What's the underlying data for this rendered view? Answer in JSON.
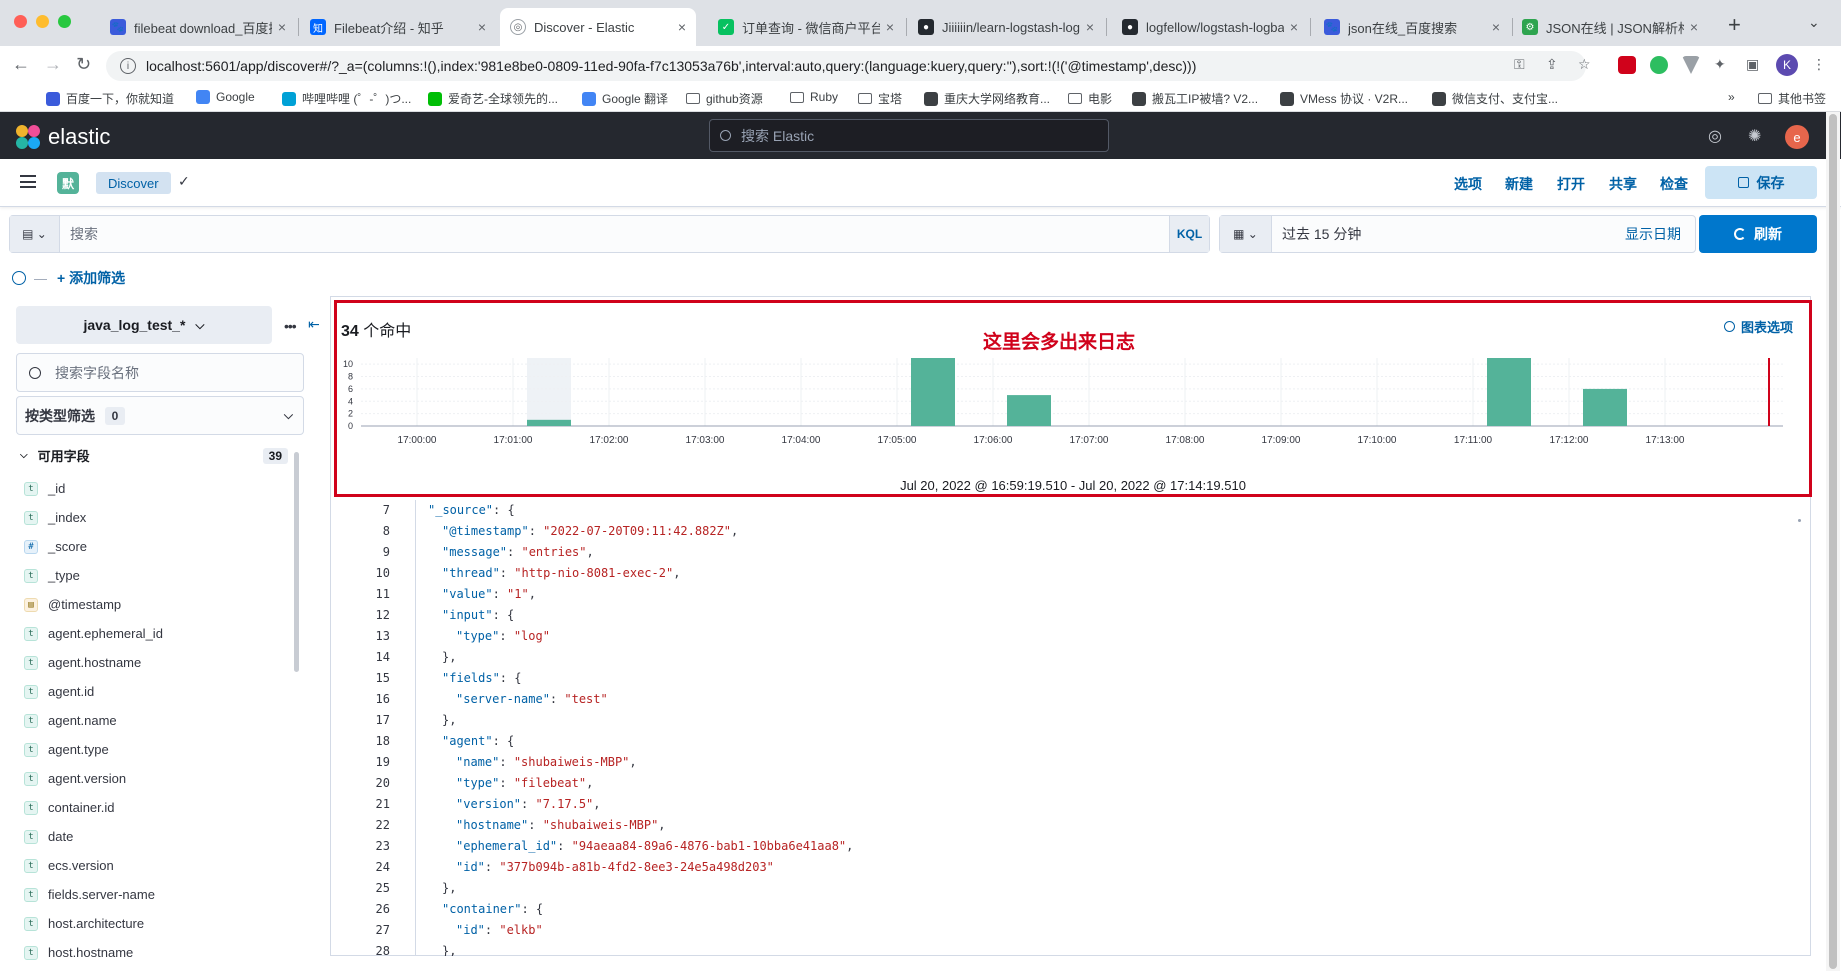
{
  "browser": {
    "tabs": [
      {
        "title": "filebeat download_百度搜",
        "fav": "#3b5bdb",
        "glyph": "🐾"
      },
      {
        "title": "Filebeat介绍 - 知乎",
        "fav": "#0066ff",
        "glyph": "知"
      },
      {
        "title": "Discover - Elastic",
        "fav": "#ffffff",
        "glyph": "◎",
        "active": true
      },
      {
        "title": "订单查询 - 微信商户平台",
        "fav": "#07c160",
        "glyph": "✓"
      },
      {
        "title": "Jiiiiiin/learn-logstash-log",
        "fav": "#24292f",
        "glyph": "●"
      },
      {
        "title": "logfellow/logstash-logba",
        "fav": "#24292f",
        "glyph": "●"
      },
      {
        "title": "json在线_百度搜索",
        "fav": "#3b5bdb",
        "glyph": "🐾"
      },
      {
        "title": "JSON在线 | JSON解析格",
        "fav": "#2ea44f",
        "glyph": "⚙"
      }
    ],
    "url": "localhost:5601/app/discover#/?_a=(columns:!(),index:'981e8be0-0809-11ed-90fa-f7c13053a76b',interval:auto,query:(language:kuery,query:''),sort:!(!('@timestamp',desc)))",
    "profile_initial": "K",
    "bookmarks": [
      "百度一下，你就知道",
      "Google",
      "哔哩哔哩 (゜-゜)つ...",
      "爱奇艺-全球领先的...",
      "Google 翻译",
      "github资源",
      "Ruby",
      "宝塔",
      "重庆大学网络教育...",
      "电影",
      "搬瓦工IP被墙? V2...",
      "VMess 协议 · V2R...",
      "微信支付、支付宝..."
    ],
    "bookmarks_more": "»",
    "other_bookmarks": "其他书签"
  },
  "kibana": {
    "logo_text": "elastic",
    "search_placeholder": "搜索 Elastic",
    "user_initial": "e",
    "space_letter": "默",
    "breadcrumb": "Discover",
    "actions": [
      "选项",
      "新建",
      "打开",
      "共享",
      "检查"
    ],
    "save_label": "保存",
    "query_placeholder": "搜索",
    "kql_label": "KQL",
    "time_range": "过去 15 分钟",
    "show_dates": "显示日期",
    "refresh_label": "刷新",
    "add_filter": "+ 添加筛选"
  },
  "sidebar": {
    "index_pattern": "java_log_test_*",
    "field_search_placeholder": "搜索字段名称",
    "type_filter_label": "按类型筛选",
    "type_filter_count": "0",
    "available_fields_label": "可用字段",
    "available_fields_count": "39",
    "fields": [
      {
        "name": "_id",
        "type": "t"
      },
      {
        "name": "_index",
        "type": "t"
      },
      {
        "name": "_score",
        "type": "n"
      },
      {
        "name": "_type",
        "type": "t"
      },
      {
        "name": "@timestamp",
        "type": "d"
      },
      {
        "name": "agent.ephemeral_id",
        "type": "t"
      },
      {
        "name": "agent.hostname",
        "type": "t"
      },
      {
        "name": "agent.id",
        "type": "t"
      },
      {
        "name": "agent.name",
        "type": "t"
      },
      {
        "name": "agent.type",
        "type": "t"
      },
      {
        "name": "agent.version",
        "type": "t"
      },
      {
        "name": "container.id",
        "type": "t"
      },
      {
        "name": "date",
        "type": "t"
      },
      {
        "name": "ecs.version",
        "type": "t"
      },
      {
        "name": "fields.server-name",
        "type": "t"
      },
      {
        "name": "host.architecture",
        "type": "t"
      },
      {
        "name": "host.hostname",
        "type": "t"
      }
    ],
    "token_glyphs": {
      "t": "t",
      "n": "#",
      "d": "▤"
    }
  },
  "histogram": {
    "hits_count": "34",
    "hits_suffix": "个命中",
    "annotation": "这里会多出来日志",
    "chart_options": "图表选项",
    "range_label": "Jul 20, 2022 @ 16:59:19.510 - Jul 20, 2022 @ 17:14:19.510"
  },
  "chart_data": {
    "type": "bar",
    "categories": [
      "17:00:00",
      "17:01:00",
      "17:02:00",
      "17:03:00",
      "17:04:00",
      "17:05:00",
      "17:06:00",
      "17:07:00",
      "17:08:00",
      "17:09:00",
      "17:10:00",
      "17:11:00",
      "17:12:00",
      "17:13:00"
    ],
    "buckets": [
      {
        "label": "17:01:00",
        "value": 1
      },
      {
        "label": "17:05:00",
        "value": 11
      },
      {
        "label": "17:06:00",
        "value": 5
      },
      {
        "label": "17:11:00",
        "value": 11
      },
      {
        "label": "17:12:00",
        "value": 6
      }
    ],
    "y_ticks": [
      0,
      2,
      4,
      6,
      8,
      10
    ],
    "ylim": [
      0,
      11
    ],
    "bar_color": "#54b399",
    "highlight_bucket": "17:01:00",
    "now_marker_color": "#d0021b"
  },
  "document": {
    "lines": [
      {
        "n": "7",
        "indent": 0,
        "parts": [
          {
            "c": "k",
            "t": "\"_source\""
          },
          {
            "c": "p",
            "t": ": {"
          }
        ]
      },
      {
        "n": "8",
        "indent": 1,
        "parts": [
          {
            "c": "k",
            "t": "\"@timestamp\""
          },
          {
            "c": "p",
            "t": ": "
          },
          {
            "c": "s",
            "t": "\"2022-07-20T09:11:42.882Z\""
          },
          {
            "c": "p",
            "t": ","
          }
        ]
      },
      {
        "n": "9",
        "indent": 1,
        "parts": [
          {
            "c": "k",
            "t": "\"message\""
          },
          {
            "c": "p",
            "t": ": "
          },
          {
            "c": "s",
            "t": "\"entries\""
          },
          {
            "c": "p",
            "t": ","
          }
        ]
      },
      {
        "n": "10",
        "indent": 1,
        "parts": [
          {
            "c": "k",
            "t": "\"thread\""
          },
          {
            "c": "p",
            "t": ": "
          },
          {
            "c": "s",
            "t": "\"http-nio-8081-exec-2\""
          },
          {
            "c": "p",
            "t": ","
          }
        ]
      },
      {
        "n": "11",
        "indent": 1,
        "parts": [
          {
            "c": "k",
            "t": "\"value\""
          },
          {
            "c": "p",
            "t": ": "
          },
          {
            "c": "s",
            "t": "\"1\""
          },
          {
            "c": "p",
            "t": ","
          }
        ]
      },
      {
        "n": "12",
        "indent": 1,
        "parts": [
          {
            "c": "k",
            "t": "\"input\""
          },
          {
            "c": "p",
            "t": ": {"
          }
        ]
      },
      {
        "n": "13",
        "indent": 2,
        "parts": [
          {
            "c": "k",
            "t": "\"type\""
          },
          {
            "c": "p",
            "t": ": "
          },
          {
            "c": "s",
            "t": "\"log\""
          }
        ]
      },
      {
        "n": "14",
        "indent": 1,
        "parts": [
          {
            "c": "p",
            "t": "},"
          }
        ]
      },
      {
        "n": "15",
        "indent": 1,
        "parts": [
          {
            "c": "k",
            "t": "\"fields\""
          },
          {
            "c": "p",
            "t": ": {"
          }
        ]
      },
      {
        "n": "16",
        "indent": 2,
        "parts": [
          {
            "c": "k",
            "t": "\"server-name\""
          },
          {
            "c": "p",
            "t": ": "
          },
          {
            "c": "s",
            "t": "\"test\""
          }
        ]
      },
      {
        "n": "17",
        "indent": 1,
        "parts": [
          {
            "c": "p",
            "t": "},"
          }
        ]
      },
      {
        "n": "18",
        "indent": 1,
        "parts": [
          {
            "c": "k",
            "t": "\"agent\""
          },
          {
            "c": "p",
            "t": ": {"
          }
        ]
      },
      {
        "n": "19",
        "indent": 2,
        "parts": [
          {
            "c": "k",
            "t": "\"name\""
          },
          {
            "c": "p",
            "t": ": "
          },
          {
            "c": "s",
            "t": "\"shubaiweis-MBP\""
          },
          {
            "c": "p",
            "t": ","
          }
        ]
      },
      {
        "n": "20",
        "indent": 2,
        "parts": [
          {
            "c": "k",
            "t": "\"type\""
          },
          {
            "c": "p",
            "t": ": "
          },
          {
            "c": "s",
            "t": "\"filebeat\""
          },
          {
            "c": "p",
            "t": ","
          }
        ]
      },
      {
        "n": "21",
        "indent": 2,
        "parts": [
          {
            "c": "k",
            "t": "\"version\""
          },
          {
            "c": "p",
            "t": ": "
          },
          {
            "c": "s",
            "t": "\"7.17.5\""
          },
          {
            "c": "p",
            "t": ","
          }
        ]
      },
      {
        "n": "22",
        "indent": 2,
        "parts": [
          {
            "c": "k",
            "t": "\"hostname\""
          },
          {
            "c": "p",
            "t": ": "
          },
          {
            "c": "s",
            "t": "\"shubaiweis-MBP\""
          },
          {
            "c": "p",
            "t": ","
          }
        ]
      },
      {
        "n": "23",
        "indent": 2,
        "parts": [
          {
            "c": "k",
            "t": "\"ephemeral_id\""
          },
          {
            "c": "p",
            "t": ": "
          },
          {
            "c": "s",
            "t": "\"94aeaa84-89a6-4876-bab1-10bba6e41aa8\""
          },
          {
            "c": "p",
            "t": ","
          }
        ]
      },
      {
        "n": "24",
        "indent": 2,
        "parts": [
          {
            "c": "k",
            "t": "\"id\""
          },
          {
            "c": "p",
            "t": ": "
          },
          {
            "c": "s",
            "t": "\"377b094b-a81b-4fd2-8ee3-24e5a498d203\""
          }
        ]
      },
      {
        "n": "25",
        "indent": 1,
        "parts": [
          {
            "c": "p",
            "t": "},"
          }
        ]
      },
      {
        "n": "26",
        "indent": 1,
        "parts": [
          {
            "c": "k",
            "t": "\"container\""
          },
          {
            "c": "p",
            "t": ": {"
          }
        ]
      },
      {
        "n": "27",
        "indent": 2,
        "parts": [
          {
            "c": "k",
            "t": "\"id\""
          },
          {
            "c": "p",
            "t": ": "
          },
          {
            "c": "s",
            "t": "\"elkb\""
          }
        ]
      },
      {
        "n": "28",
        "indent": 1,
        "parts": [
          {
            "c": "p",
            "t": "},"
          }
        ]
      }
    ]
  }
}
